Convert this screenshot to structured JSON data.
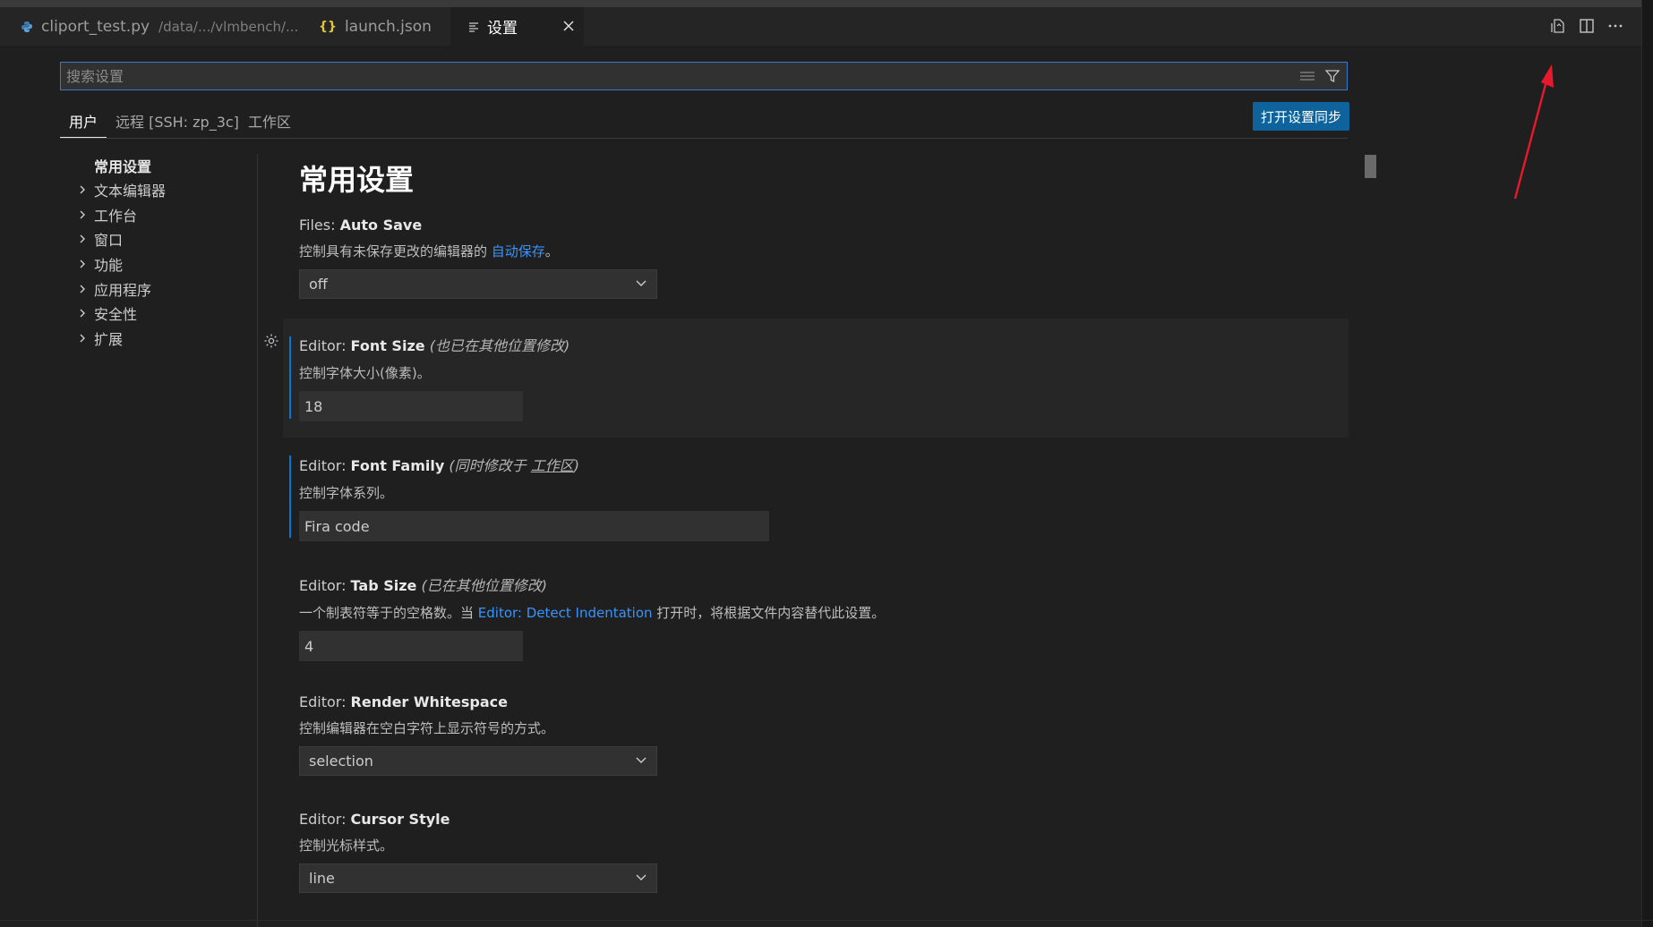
{
  "tabs": [
    {
      "label": "cliport_test.py",
      "description": "/data/.../vlmbench/...",
      "icon": "python-icon"
    },
    {
      "label": "launch.json",
      "icon": "json-braces-icon",
      "icon_text": "{}"
    },
    {
      "label": "设置",
      "icon": "settings-file-icon",
      "active": true
    }
  ],
  "topbar_icons": [
    "open-settings-json-icon",
    "split-editor-icon",
    "more-actions-icon"
  ],
  "search": {
    "placeholder": "搜索设置",
    "value": ""
  },
  "scope_tabs": [
    "用户",
    "远程 [SSH: zp_3c]",
    "工作区"
  ],
  "sync_button": "打开设置同步",
  "toc": {
    "active": "常用设置",
    "items": [
      "文本编辑器",
      "工作台",
      "窗口",
      "功能",
      "应用程序",
      "安全性",
      "扩展"
    ]
  },
  "section_title": "常用设置",
  "settings": {
    "auto_save": {
      "category": "Files: ",
      "name": "Auto Save",
      "desc_pre": "控制具有未保存更改的编辑器的 ",
      "desc_link": "自动保存",
      "desc_post": "。",
      "value": "off"
    },
    "font_size": {
      "category": "Editor: ",
      "name": "Font Size",
      "note": "(也已在其他位置修改)",
      "desc": "控制字体大小(像素)。",
      "value": "18"
    },
    "font_family": {
      "category": "Editor: ",
      "name": "Font Family",
      "note_pre": "(同时修改于 ",
      "note_link": "工作区",
      "note_post": ")",
      "desc": "控制字体系列。",
      "value": "Fira code"
    },
    "tab_size": {
      "category": "Editor: ",
      "name": "Tab Size",
      "note": "(已在其他位置修改)",
      "desc_pre": "一个制表符等于的空格数。当 ",
      "desc_link": "Editor: Detect Indentation",
      "desc_post": " 打开时，将根据文件内容替代此设置。",
      "value": "4"
    },
    "render_whitespace": {
      "category": "Editor: ",
      "name": "Render Whitespace",
      "desc": "控制编辑器在空白字符上显示符号的方式。",
      "value": "selection"
    },
    "cursor_style": {
      "category": "Editor: ",
      "name": "Cursor Style",
      "desc": "控制光标样式。",
      "value": "line"
    }
  },
  "colors": {
    "accent": "#0078d4",
    "link": "#3794ff",
    "button": "#0e639c",
    "annotation_arrow": "#e8192c"
  }
}
